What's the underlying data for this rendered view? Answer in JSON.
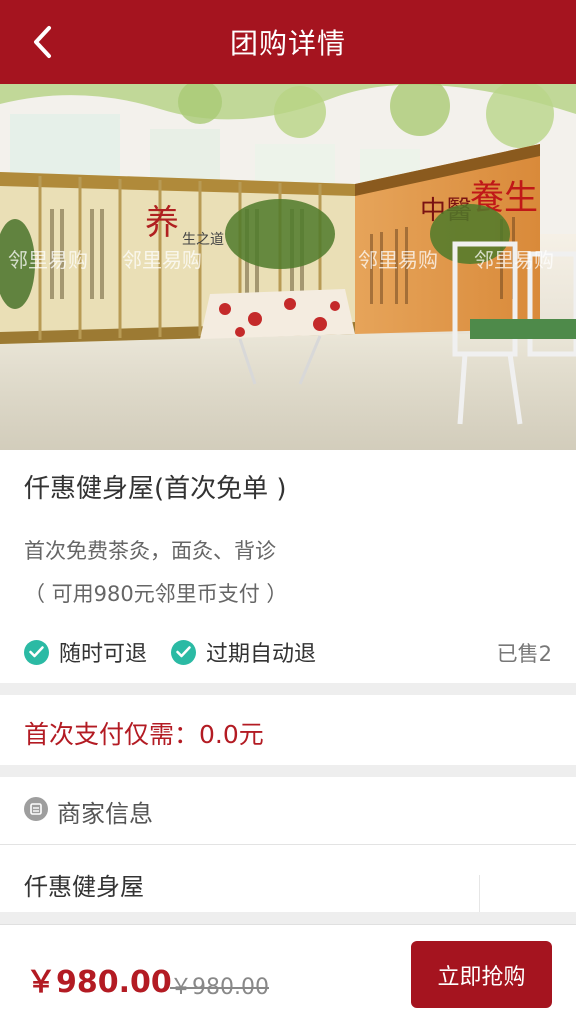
{
  "header": {
    "title": "团购详情"
  },
  "hero": {
    "watermark": "邻里易购",
    "screen_left_text": "养生之道",
    "screen_right_text": "中醫養生"
  },
  "product": {
    "title": "仟惠健身屋(首次免单 )",
    "desc_line1": "首次免费茶灸，面灸、背诊",
    "desc_line2": "（ 可用980元邻里币支付 ）",
    "tags": [
      "随时可退",
      "过期自动退"
    ],
    "sold": "已售2"
  },
  "payment": {
    "first_pay": "首次支付仅需：0.0元"
  },
  "merchant": {
    "section_label": "商家信息",
    "name": "仟惠健身屋"
  },
  "footer": {
    "price": "￥980.00",
    "original_price": "￥980.00",
    "buy_label": "立即抢购"
  },
  "colors": {
    "brand": "#a5141f",
    "price_red": "#b31b23",
    "check_teal": "#2bbaa4"
  }
}
